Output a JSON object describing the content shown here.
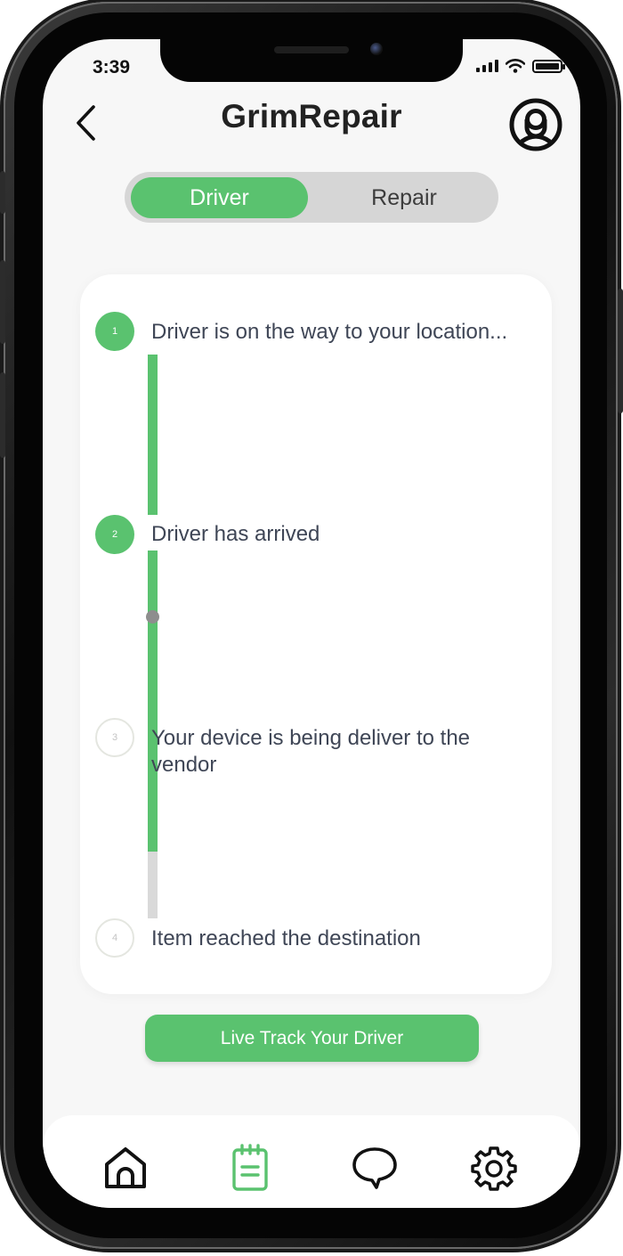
{
  "status_bar": {
    "time": "3:39"
  },
  "header": {
    "title": "GrimRepair"
  },
  "tabs": [
    {
      "label": "Driver",
      "active": true
    },
    {
      "label": "Repair",
      "active": false
    }
  ],
  "timeline": {
    "steps": [
      {
        "number": "1",
        "text": "Driver is on the way to your location...",
        "status": "done"
      },
      {
        "number": "2",
        "text": "Driver has arrived",
        "status": "done"
      },
      {
        "number": "3",
        "text": "Your device is being deliver to the vendor",
        "status": "pending"
      },
      {
        "number": "4",
        "text": "Item reached the destination",
        "status": "pending"
      }
    ]
  },
  "actions": {
    "live_track_label": "Live Track Your Driver"
  },
  "bottom_nav": {
    "items": [
      {
        "icon": "home-icon",
        "active": false
      },
      {
        "icon": "clipboard-icon",
        "active": true
      },
      {
        "icon": "chat-bubble-icon",
        "active": false
      },
      {
        "icon": "settings-gear-icon",
        "active": false
      }
    ]
  },
  "colors": {
    "accent": "#5ac26f",
    "pending_line": "#d9d9d9",
    "text": "#3f4656",
    "frame": "#111111"
  }
}
